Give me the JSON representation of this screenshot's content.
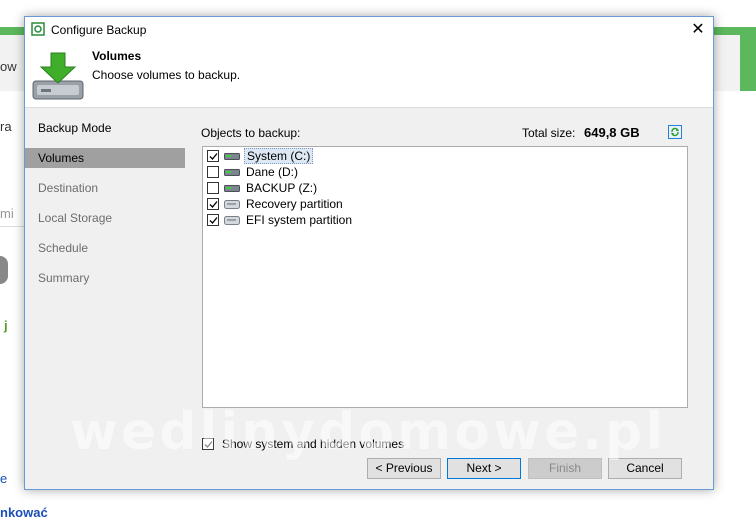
{
  "background": {
    "fragments": [
      "ow",
      "ra",
      "mi",
      "j",
      "e",
      "nkować"
    ]
  },
  "window": {
    "title": "Configure Backup",
    "close_glyph": "✕"
  },
  "header": {
    "title": "Volumes",
    "subtitle": "Choose volumes to backup."
  },
  "nav": {
    "items": [
      {
        "label": "Backup Mode"
      },
      {
        "label": "Volumes"
      },
      {
        "label": "Destination"
      },
      {
        "label": "Local Storage"
      },
      {
        "label": "Schedule"
      },
      {
        "label": "Summary"
      }
    ],
    "active": "Volumes"
  },
  "content": {
    "objects_label": "Objects to backup:",
    "total_label": "Total size:",
    "total_value": "649,8 GB",
    "volumes": [
      {
        "label": "System (C:)",
        "checked": true,
        "icon": "hard-drive-icon"
      },
      {
        "label": "Dane (D:)",
        "checked": false,
        "icon": "hard-drive-icon"
      },
      {
        "label": "BACKUP (Z:)",
        "checked": false,
        "icon": "hard-drive-icon"
      },
      {
        "label": "Recovery partition",
        "checked": true,
        "icon": "partition-icon"
      },
      {
        "label": "EFI system partition",
        "checked": true,
        "icon": "partition-icon"
      }
    ],
    "show_hidden_label": "Show system and hidden volumes",
    "show_hidden_checked": true
  },
  "buttons": {
    "previous": "< Previous",
    "next": "Next >",
    "finish": "Finish",
    "cancel": "Cancel"
  },
  "watermark": "wedlinydomowe.pl",
  "colors": {
    "accent": "#0078d7",
    "nav_active": "#a0a0a0",
    "green_bar": "#5cb85c"
  }
}
